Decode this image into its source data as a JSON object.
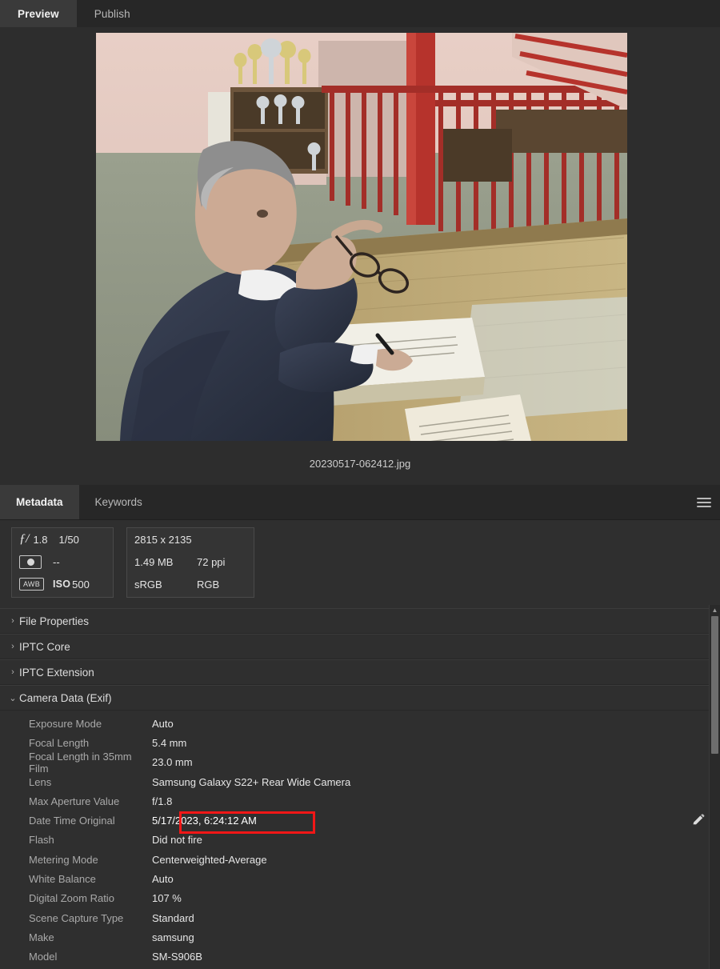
{
  "top_tabs": [
    {
      "label": "Preview",
      "active": true
    },
    {
      "label": "Publish",
      "active": false
    }
  ],
  "preview": {
    "filename": "20230517-062412.jpg",
    "image_alt": "Man in dark blue suit seated at a table, holding eyeglasses in one hand and a pen in the other, signing an open guest book; trophy cabinet and red railings in background"
  },
  "metadata_panel": {
    "tabs": [
      {
        "label": "Metadata",
        "active": true
      },
      {
        "label": "Keywords",
        "active": false
      }
    ],
    "menu_icon": "hamburger-menu-icon",
    "camera_card": {
      "aperture_glyph": "ƒ/",
      "aperture": "1.8",
      "shutter": "1/50",
      "metering_icon": "metering-mode-icon",
      "metering_value": "--",
      "awb_icon": "AWB",
      "iso_label": "ISO",
      "iso_value": "500"
    },
    "file_card": {
      "dimensions": "2815 x 2135",
      "filesize": "1.49 MB",
      "resolution": "72 ppi",
      "color_profile": "sRGB",
      "color_mode": "RGB"
    },
    "sections": [
      {
        "label": "File Properties",
        "expanded": false,
        "twisty": "›"
      },
      {
        "label": "IPTC Core",
        "expanded": false,
        "twisty": "›"
      },
      {
        "label": "IPTC Extension",
        "expanded": false,
        "twisty": "›"
      },
      {
        "label": "Camera Data (Exif)",
        "expanded": true,
        "twisty": "⌄"
      }
    ],
    "exif_rows": [
      {
        "label": "Exposure Mode",
        "value": "Auto",
        "highlighted": false
      },
      {
        "label": "Focal Length",
        "value": "5.4 mm",
        "highlighted": false
      },
      {
        "label": "Focal Length in 35mm Film",
        "value": "23.0 mm",
        "highlighted": false
      },
      {
        "label": "Lens",
        "value": "Samsung Galaxy S22+ Rear Wide Camera",
        "highlighted": false
      },
      {
        "label": "Max Aperture Value",
        "value": "f/1.8",
        "highlighted": false
      },
      {
        "label": "Date Time Original",
        "value": "5/17/2023, 6:24:12 AM",
        "highlighted": true
      },
      {
        "label": "Flash",
        "value": "Did not fire",
        "highlighted": false
      },
      {
        "label": "Metering Mode",
        "value": "Centerweighted-Average",
        "highlighted": false
      },
      {
        "label": "White Balance",
        "value": "Auto",
        "highlighted": false
      },
      {
        "label": "Digital Zoom Ratio",
        "value": "107 %",
        "highlighted": false
      },
      {
        "label": "Scene Capture Type",
        "value": "Standard",
        "highlighted": false
      },
      {
        "label": "Make",
        "value": "samsung",
        "highlighted": false
      },
      {
        "label": "Model",
        "value": "SM-S906B",
        "highlighted": false
      }
    ],
    "edit_icon": "pencil-edit-icon",
    "scrollbar": {
      "up_arrow": "▲",
      "down_arrow": "▼"
    }
  },
  "colors": {
    "highlight": "#f21717",
    "panel_bg": "#2f2f2f",
    "tabbar_bg": "#272727",
    "active_tab_bg": "#3a3a3a"
  }
}
